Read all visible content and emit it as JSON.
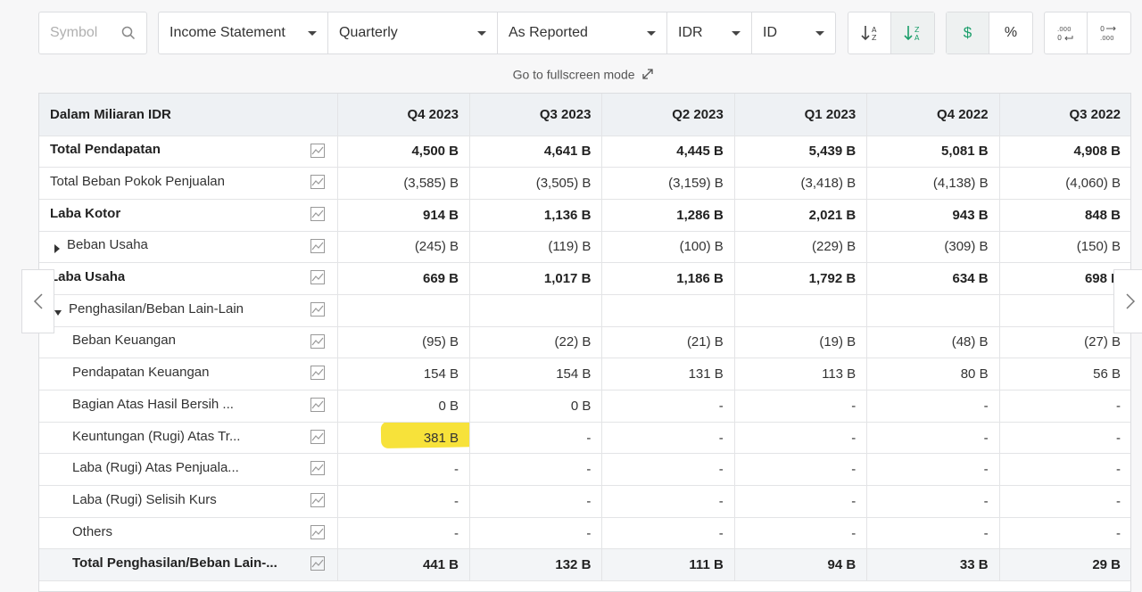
{
  "toolbar": {
    "symbol_placeholder": "Symbol",
    "statement": "Income Statement",
    "period": "Quarterly",
    "reporting": "As Reported",
    "currency": "IDR",
    "language": "ID",
    "sort_asc_icon": "sort-ascending-icon",
    "sort_desc_icon": "sort-descending-icon",
    "dollar_label": "$",
    "percent_label": "%",
    "decimal_decrease_icon": "decimal-decrease-icon",
    "decimal_increase_icon": "decimal-increase-icon",
    "accent_color": "#1a9e6a"
  },
  "fullscreen_label": "Go to fullscreen mode",
  "table": {
    "header_label": "Dalam Miliaran IDR",
    "columns": [
      "Q4 2023",
      "Q3 2023",
      "Q2 2023",
      "Q1 2023",
      "Q4 2022",
      "Q3 2022"
    ],
    "rows": [
      {
        "label": "Total Pendapatan",
        "style": "bold",
        "values": [
          "4,500 B",
          "4,641 B",
          "4,445 B",
          "5,439 B",
          "5,081 B",
          "4,908 B"
        ]
      },
      {
        "label": "Total Beban Pokok Penjualan",
        "style": "normal",
        "values": [
          "(3,585) B",
          "(3,505) B",
          "(3,159) B",
          "(3,418) B",
          "(4,138) B",
          "(4,060) B"
        ]
      },
      {
        "label": "Laba Kotor",
        "style": "bold",
        "values": [
          "914 B",
          "1,136 B",
          "1,286 B",
          "2,021 B",
          "943 B",
          "848 B"
        ]
      },
      {
        "label": "Beban Usaha",
        "style": "collapsed",
        "values": [
          "(245) B",
          "(119) B",
          "(100) B",
          "(229) B",
          "(309) B",
          "(150) B"
        ]
      },
      {
        "label": "Laba Usaha",
        "style": "bold",
        "values": [
          "669 B",
          "1,017 B",
          "1,186 B",
          "1,792 B",
          "634 B",
          "698 B"
        ]
      },
      {
        "label": "Penghasilan/Beban Lain-Lain",
        "style": "expanded",
        "values": [
          "",
          "",
          "",
          "",
          "",
          ""
        ]
      },
      {
        "label": "Beban Keuangan",
        "style": "sub",
        "values": [
          "(95) B",
          "(22) B",
          "(21) B",
          "(19) B",
          "(48) B",
          "(27) B"
        ]
      },
      {
        "label": "Pendapatan Keuangan",
        "style": "sub",
        "values": [
          "154 B",
          "154 B",
          "131 B",
          "113 B",
          "80 B",
          "56 B"
        ]
      },
      {
        "label": "Bagian Atas Hasil Bersih ...",
        "style": "sub",
        "values": [
          "0 B",
          "0 B",
          "-",
          "-",
          "-",
          "-"
        ]
      },
      {
        "label": "Keuntungan (Rugi) Atas Tr...",
        "style": "sub",
        "highlight": 0,
        "values": [
          "381 B",
          "-",
          "-",
          "-",
          "-",
          "-"
        ]
      },
      {
        "label": "Laba (Rugi) Atas Penjuala...",
        "style": "sub",
        "values": [
          "-",
          "-",
          "-",
          "-",
          "-",
          "-"
        ]
      },
      {
        "label": "Laba (Rugi) Selisih Kurs",
        "style": "sub",
        "values": [
          "-",
          "-",
          "-",
          "-",
          "-",
          "-"
        ]
      },
      {
        "label": "Others",
        "style": "sub",
        "values": [
          "-",
          "-",
          "-",
          "-",
          "-",
          "-"
        ]
      },
      {
        "label": "Total Penghasilan/Beban Lain-...",
        "style": "subtotal",
        "values": [
          "441 B",
          "132 B",
          "111 B",
          "94 B",
          "33 B",
          "29 B"
        ]
      }
    ]
  },
  "nav": {
    "prev_icon": "chevron-left-icon",
    "next_icon": "chevron-right-icon"
  }
}
